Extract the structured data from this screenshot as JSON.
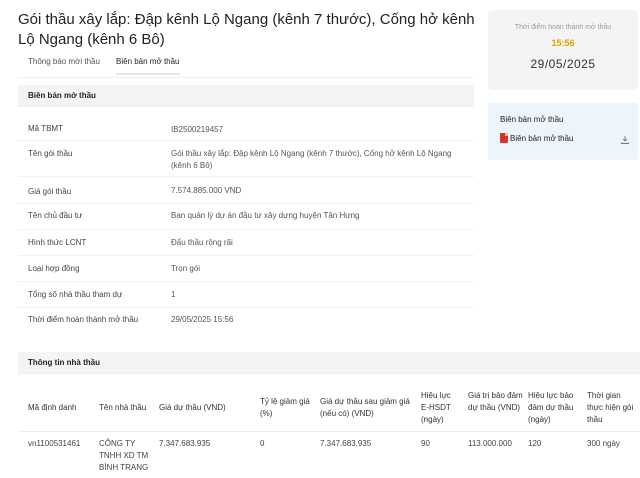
{
  "title": "Gói thầu xây lắp: Đập kênh Lộ Ngang (kênh 7 thước), Cống hở kênh Lộ Ngang (kênh 6 Bô)",
  "tabs": [
    {
      "label": "Thông báo mời thầu"
    },
    {
      "label": "Biên bản mở thầu"
    }
  ],
  "section1": {
    "title": "Biên bản mở thầu",
    "rows": [
      {
        "label": "Mã TBMT",
        "value": "IB2500219457"
      },
      {
        "label": "Tên gói thầu",
        "value": "Gói thầu xây lắp: Đập kênh Lộ Ngang (kênh 7 thước), Cống hở kênh Lộ Ngang (kênh 6 Bô)"
      },
      {
        "label": "Giá gói thầu",
        "value": "7.574.885.000 VND"
      },
      {
        "label": "Tên chủ đầu tư",
        "value": "Ban quản lý dự án đầu tư xây dựng huyện Tân Hưng"
      },
      {
        "label": "Hình thức LCNT",
        "value": "Đấu thầu rộng rãi"
      },
      {
        "label": "Loại hợp đồng",
        "value": "Trọn gói"
      },
      {
        "label": "Tổng số nhà thầu tham dự",
        "value": "1"
      },
      {
        "label": "Thời điểm hoàn thành mở thầu",
        "value": "29/05/2025 15:56"
      }
    ]
  },
  "completion": {
    "label": "Thời điểm hoàn thành mở thầu",
    "time": "15:56",
    "date": "29/05/2025"
  },
  "documents": {
    "title": "Biên bản mở thầu",
    "file_label": "Biên bản mở thầu",
    "icons": [
      "pdf-icon",
      "download-icon"
    ]
  },
  "section2": {
    "title": "Thông tin nhà thầu",
    "headers": [
      "Mã định danh",
      "Tên nhà thầu",
      "Giá dự thầu (VND)",
      "Tỷ lệ giảm giá (%)",
      "Giá dự thầu sau giảm giá (nếu có) (VND)",
      "Hiệu lực E-HSDT (ngày)",
      "Giá trị bảo đảm dự thầu (VND)",
      "Hiệu lực bảo đảm dự thầu (ngày)",
      "Thời gian thực hiện gói thầu"
    ],
    "rows": [
      [
        "vn1100531461",
        "CÔNG TY TNHH XD TM BÌNH TRANG",
        "7.347.683.935",
        "0",
        "7.347.683.935",
        "90",
        "113.000.000",
        "120",
        "300 ngày"
      ]
    ]
  },
  "colors": {
    "accent_time": "#e0a000",
    "section_bg": "#f4f4f6",
    "doc_card_bg": "#eef4fb",
    "pdf_red": "#d9342b"
  }
}
